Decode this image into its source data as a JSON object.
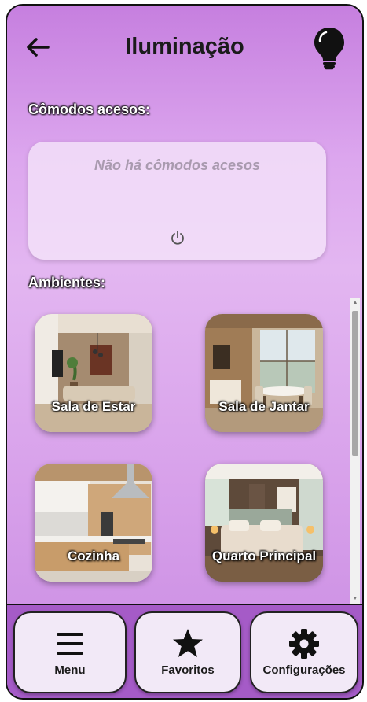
{
  "header": {
    "title": "Iluminação",
    "back_icon": "arrow-left-icon",
    "bulb_icon": "lightbulb-icon"
  },
  "lit_rooms": {
    "label": "Cômodos acesos:",
    "empty_message": "Não há cômodos acesos",
    "power_icon": "power-icon"
  },
  "environments": {
    "label": "Ambientes:",
    "rooms": [
      {
        "name": "Sala de Estar"
      },
      {
        "name": "Sala de Jantar"
      },
      {
        "name": "Cozinha"
      },
      {
        "name": "Quarto Principal"
      }
    ]
  },
  "nav": {
    "menu": "Menu",
    "favorites": "Favoritos",
    "settings": "Configurações"
  },
  "colors": {
    "gradient_top": "#c67fdf",
    "gradient_mid": "#e3b6f1",
    "nav_bar": "#a55bc7",
    "nav_button": "#f2e9f7"
  }
}
